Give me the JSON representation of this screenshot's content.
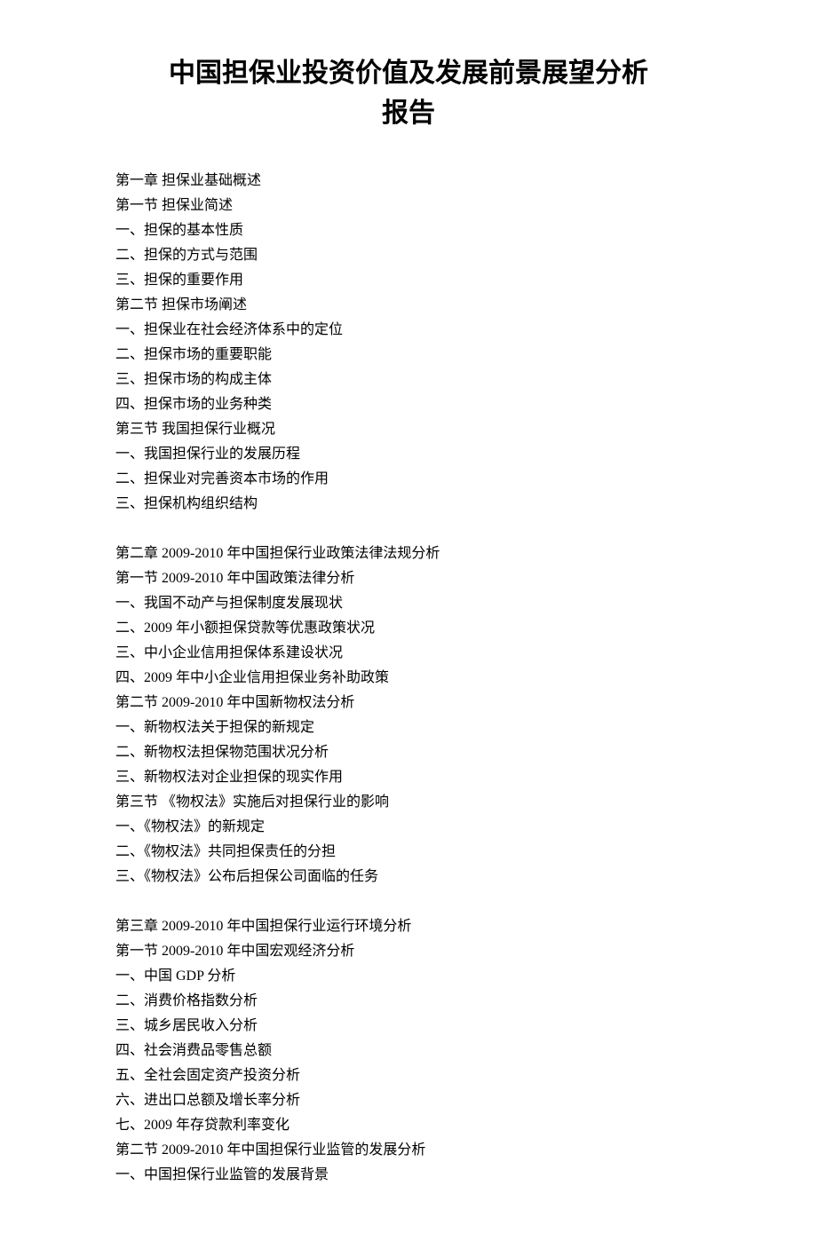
{
  "title_line1": "中国担保业投资价值及发展前景展望分析",
  "title_line2": "报告",
  "toc": [
    {
      "lines": [
        "第一章  担保业基础概述",
        "第一节  担保业简述",
        "一、担保的基本性质",
        "二、担保的方式与范围",
        "三、担保的重要作用",
        "第二节  担保市场阐述",
        "一、担保业在社会经济体系中的定位",
        "二、担保市场的重要职能",
        "三、担保市场的构成主体",
        "四、担保市场的业务种类",
        "第三节  我国担保行业概况",
        "一、我国担保行业的发展历程",
        "二、担保业对完善资本市场的作用",
        "三、担保机构组织结构"
      ]
    },
    {
      "lines": [
        "第二章  2009-2010 年中国担保行业政策法律法规分析",
        "第一节  2009-2010 年中国政策法律分析",
        "一、我国不动产与担保制度发展现状",
        "二、2009 年小额担保贷款等优惠政策状况",
        "三、中小企业信用担保体系建设状况",
        "四、2009 年中小企业信用担保业务补助政策",
        "第二节  2009-2010 年中国新物权法分析",
        "一、新物权法关于担保的新规定",
        "二、新物权法担保物范围状况分析",
        "三、新物权法对企业担保的现实作用",
        "第三节  《物权法》实施后对担保行业的影响",
        "一、《物权法》的新规定",
        "二、《物权法》共同担保责任的分担",
        "三、《物权法》公布后担保公司面临的任务"
      ]
    },
    {
      "lines": [
        "第三章  2009-2010 年中国担保行业运行环境分析",
        "第一节    2009-2010 年中国宏观经济分析",
        "一、中国 GDP 分析",
        "二、消费价格指数分析",
        "三、城乡居民收入分析",
        "四、社会消费品零售总额",
        "五、全社会固定资产投资分析",
        "六、进出口总额及增长率分析",
        "七、2009 年存贷款利率变化",
        "第二节    2009-2010 年中国担保行业监管的发展分析",
        "一、中国担保行业监管的发展背景"
      ]
    }
  ]
}
